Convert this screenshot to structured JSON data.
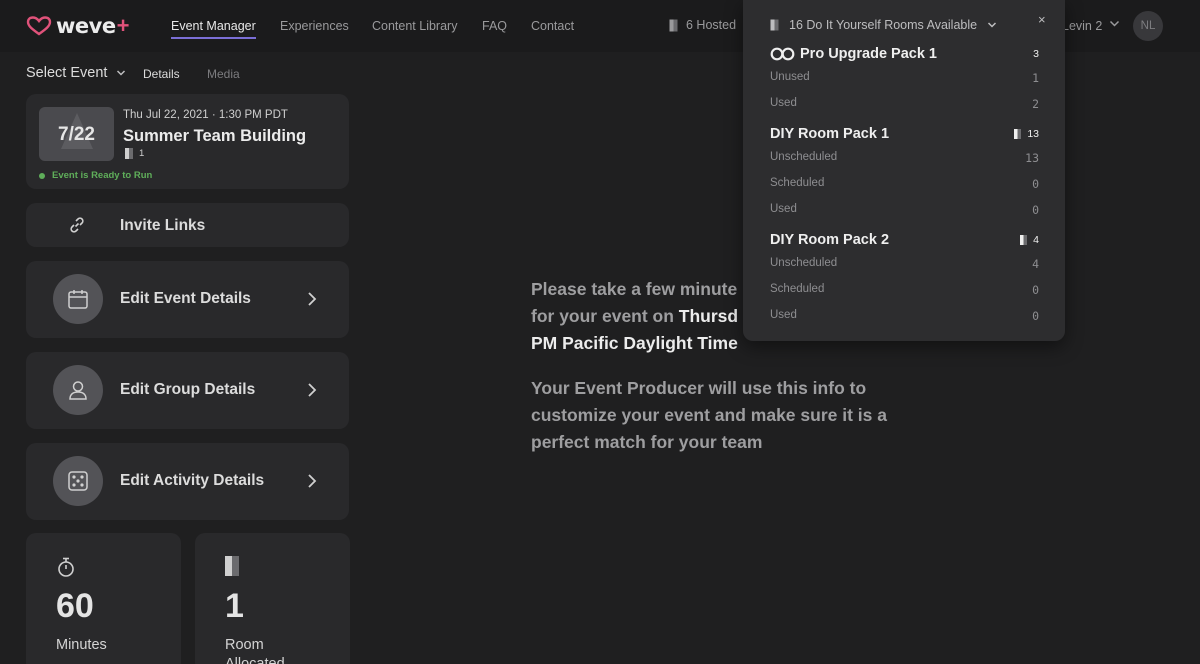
{
  "brand": {
    "name": "weve",
    "plus": "+"
  },
  "nav": {
    "links": [
      "Event Manager",
      "Experiences",
      "Content Library",
      "FAQ",
      "Contact"
    ],
    "hosted": "6 Hosted",
    "user_name": "Levin 2",
    "avatar_initials": "NL"
  },
  "subheader": {
    "select_event": "Select Event",
    "tabs": [
      "Details",
      "Media"
    ]
  },
  "event": {
    "date_tile": "7/22",
    "datetime": "Thu Jul 22, 2021 · 1:30 PM PDT",
    "name": "Summer Team Building",
    "rooms": "1",
    "status": "Event is Ready to Run"
  },
  "actions": {
    "invite": "Invite Links",
    "edit_event": "Edit Event Details",
    "edit_group": "Edit Group Details",
    "edit_activity": "Edit Activity Details"
  },
  "stats": [
    {
      "value": "60",
      "unit": "Minutes"
    },
    {
      "value": "1",
      "unit": "Room Allocated"
    }
  ],
  "message": {
    "line1_start": "Please take a few minute",
    "line2_start": "for your event on ",
    "line2_bold": "Thursd",
    "line3_bold": "PM Pacific Daylight Time",
    "para2": "Your Event Producer will use this info to customize your event and make sure it is a perfect match for your team"
  },
  "dropdown": {
    "header": "16 Do It Yourself Rooms Available",
    "close": "×",
    "packs": [
      {
        "title": "Pro Upgrade Pack 1",
        "count": "3",
        "rows": [
          {
            "label": "Unused",
            "value": "1"
          },
          {
            "label": "Used",
            "value": "2"
          }
        ]
      },
      {
        "title": "DIY Room Pack 1",
        "count": "13",
        "rows": [
          {
            "label": "Unscheduled",
            "value": "13"
          },
          {
            "label": "Scheduled",
            "value": "0"
          },
          {
            "label": "Used",
            "value": "0"
          }
        ]
      },
      {
        "title": "DIY Room Pack 2",
        "count": "4",
        "rows": [
          {
            "label": "Unscheduled",
            "value": "4"
          },
          {
            "label": "Scheduled",
            "value": "0"
          },
          {
            "label": "Used",
            "value": "0"
          }
        ]
      }
    ]
  },
  "colors": {
    "accent": "#7b6fd6",
    "brand_plus": "#e0527a",
    "ready": "#5fae5a",
    "background": "#1f1f20",
    "card": "#29292b"
  }
}
